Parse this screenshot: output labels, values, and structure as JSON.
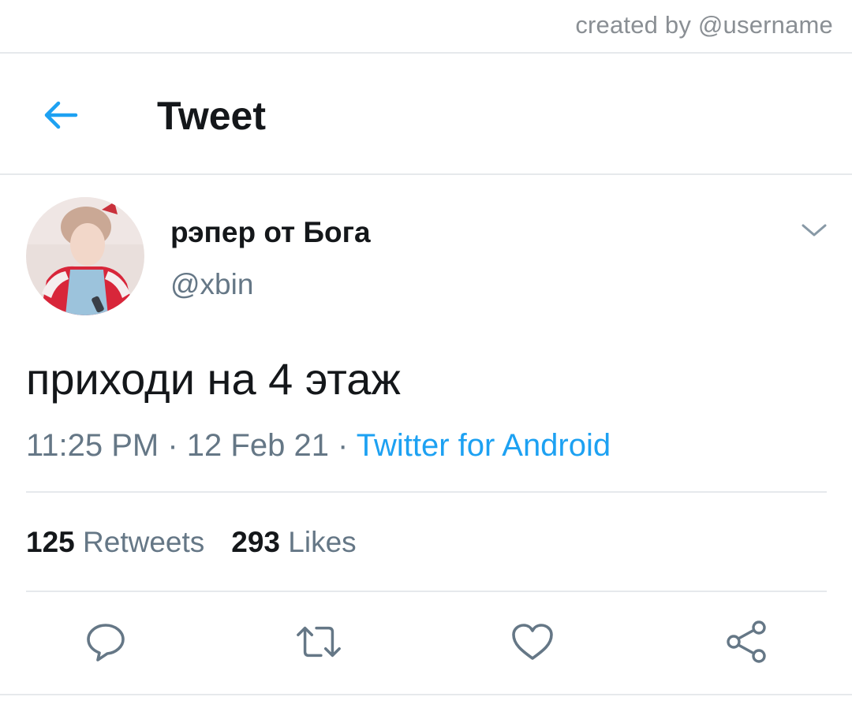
{
  "watermark": "created by @username",
  "header": {
    "title": "Tweet",
    "back_icon": "arrow-left-icon",
    "accent_color": "#1da1f2"
  },
  "tweet": {
    "author": {
      "display_name": "рэпер от Бога",
      "handle": "@xbin"
    },
    "text": "приходи на 4 этаж",
    "time": "11:25 PM",
    "date": "12 Feb 21",
    "separator": " · ",
    "source": "Twitter for Android",
    "stats": {
      "retweets_count": "125",
      "retweets_label": "Retweets",
      "likes_count": "293",
      "likes_label": "Likes"
    }
  },
  "actions": [
    {
      "icon": "reply-icon"
    },
    {
      "icon": "retweet-icon"
    },
    {
      "icon": "like-icon"
    },
    {
      "icon": "share-icon"
    }
  ],
  "colors": {
    "text": "#14171a",
    "secondary": "#657786",
    "divider": "#e6e9ec",
    "link": "#1da1f2"
  }
}
